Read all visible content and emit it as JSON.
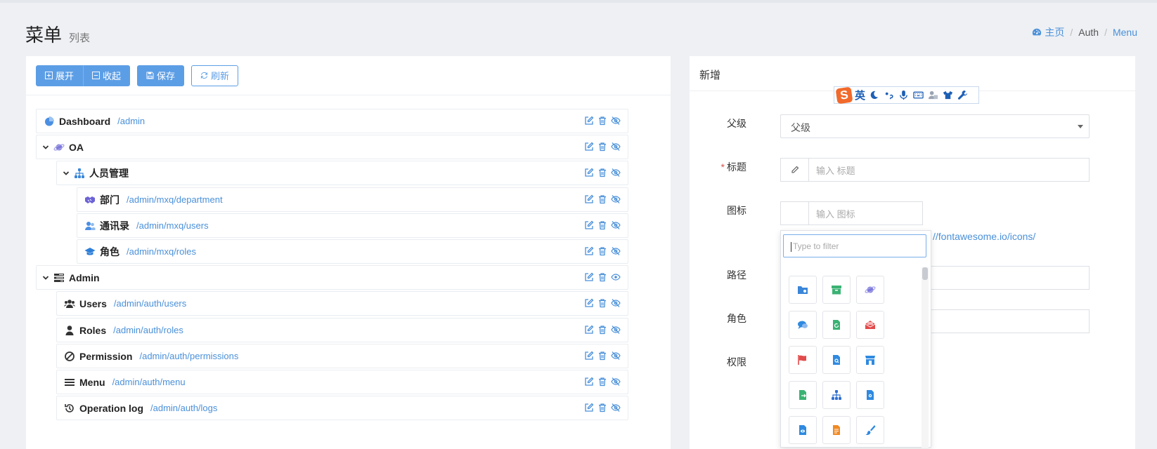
{
  "header": {
    "title": "菜单",
    "subtitle": "列表"
  },
  "breadcrumb": {
    "home": "主页",
    "second": "Auth",
    "current": "Menu"
  },
  "toolbar": {
    "expand": "展开",
    "collapse": "收起",
    "save": "保存",
    "refresh": "刷新"
  },
  "tree": [
    {
      "name": "Dashboard",
      "uri": "/admin",
      "icon": "pie-chart-icon",
      "level": 0,
      "expanded": null,
      "visible": false
    },
    {
      "name": "OA",
      "uri": "",
      "icon": "planet-icon",
      "level": 0,
      "expanded": true,
      "visible": false
    },
    {
      "name": "人员管理",
      "uri": "",
      "icon": "sitemap-icon",
      "level": 1,
      "expanded": true,
      "visible": false
    },
    {
      "name": "部门",
      "uri": "/admin/mxq/department",
      "icon": "handshake-icon",
      "level": 2,
      "expanded": null,
      "visible": false
    },
    {
      "name": "通讯录",
      "uri": "/admin/mxq/users",
      "icon": "contacts-icon",
      "level": 2,
      "expanded": null,
      "visible": false
    },
    {
      "name": "角色",
      "uri": "/admin/mxq/roles",
      "icon": "graduation-cap-icon",
      "level": 2,
      "expanded": null,
      "visible": false
    },
    {
      "name": "Admin",
      "uri": "",
      "icon": "tasks-icon",
      "level": 0,
      "expanded": true,
      "visible": true
    },
    {
      "name": "Users",
      "uri": "/admin/auth/users",
      "icon": "users-icon",
      "level": 1,
      "expanded": null,
      "visible": false
    },
    {
      "name": "Roles",
      "uri": "/admin/auth/roles",
      "icon": "user-icon",
      "level": 1,
      "expanded": null,
      "visible": false
    },
    {
      "name": "Permission",
      "uri": "/admin/auth/permissions",
      "icon": "ban-icon",
      "level": 1,
      "expanded": null,
      "visible": false
    },
    {
      "name": "Menu",
      "uri": "/admin/auth/menu",
      "icon": "bars-icon",
      "level": 1,
      "expanded": null,
      "visible": false
    },
    {
      "name": "Operation log",
      "uri": "/admin/auth/logs",
      "icon": "history-icon",
      "level": 1,
      "expanded": null,
      "visible": false
    }
  ],
  "form": {
    "title": "新增",
    "parent_label": "父级",
    "parent_value": "父级",
    "title_label": "标题",
    "title_placeholder": "输入 标题",
    "icon_label": "图标",
    "icon_placeholder": "输入 图标",
    "icon_help": "//fontawesome.io/icons/",
    "uri_label": "路径",
    "roles_label": "角色",
    "permission_label": "权限"
  },
  "picker": {
    "filter_placeholder": "Type to filter",
    "icons": [
      {
        "name": "folder-icon",
        "color": "#3a86d8"
      },
      {
        "name": "archive-icon",
        "color": "#3bb273"
      },
      {
        "name": "planet-icon",
        "color": "#7e7ad9"
      },
      {
        "name": "comments-icon",
        "color": "#2f8ae0"
      },
      {
        "name": "file-refresh-icon",
        "color": "#3bb273"
      },
      {
        "name": "mail-open-icon",
        "color": "#e24b4b"
      },
      {
        "name": "flag-icon",
        "color": "#e24b4b"
      },
      {
        "name": "file-search-icon",
        "color": "#2f8ae0"
      },
      {
        "name": "store-icon",
        "color": "#2f8ae0"
      },
      {
        "name": "file-export-icon",
        "color": "#3bb273"
      },
      {
        "name": "sitemap-icon",
        "color": "#2f6fd1"
      },
      {
        "name": "file-settings-icon",
        "color": "#2f8ae0"
      },
      {
        "name": "file-view-icon",
        "color": "#2f8ae0"
      },
      {
        "name": "file-text-icon",
        "color": "#f08a24"
      },
      {
        "name": "brush-icon",
        "color": "#2f8ae0"
      }
    ]
  },
  "colors": {
    "primary": "#5c9ee6",
    "link": "#4a90d9",
    "required": "#d9534f"
  }
}
